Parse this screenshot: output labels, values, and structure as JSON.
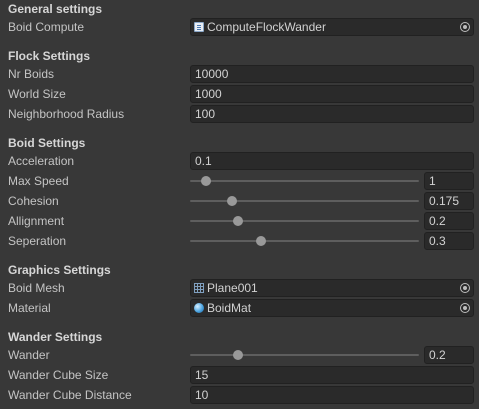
{
  "general": {
    "header": "General settings",
    "boid_compute": {
      "label": "Boid Compute",
      "value": "ComputeFlockWander",
      "icon": "script-icon"
    }
  },
  "flock": {
    "header": "Flock Settings",
    "nr_boids": {
      "label": "Nr Boids",
      "value": "10000"
    },
    "world_size": {
      "label": "World Size",
      "value": "1000"
    },
    "neighborhood_radius": {
      "label": "Neighborhood Radius",
      "value": "100"
    }
  },
  "boid": {
    "header": "Boid Settings",
    "acceleration": {
      "label": "Acceleration",
      "value": "0.1"
    },
    "max_speed": {
      "label": "Max Speed",
      "value": "1",
      "level": 0.07
    },
    "cohesion": {
      "label": "Cohesion",
      "value": "0.175",
      "level": 0.185
    },
    "allignment": {
      "label": "Allignment",
      "value": "0.2",
      "level": 0.21
    },
    "seperation": {
      "label": "Seperation",
      "value": "0.3",
      "level": 0.31
    }
  },
  "graphics": {
    "header": "Graphics Settings",
    "boid_mesh": {
      "label": "Boid Mesh",
      "value": "Plane001",
      "icon": "mesh-icon"
    },
    "material": {
      "label": "Material",
      "value": "BoidMat",
      "icon": "material-icon"
    }
  },
  "wander": {
    "header": "Wander Settings",
    "wander": {
      "label": "Wander",
      "value": "0.2",
      "level": 0.21
    },
    "cube_size": {
      "label": "Wander Cube Size",
      "value": "15"
    },
    "cube_distance": {
      "label": "Wander Cube Distance",
      "value": "10"
    }
  },
  "colors": {
    "background": "#383838",
    "field": "#2a2a2a",
    "text": "#c4c4c4",
    "slider_thumb": "#999999"
  }
}
